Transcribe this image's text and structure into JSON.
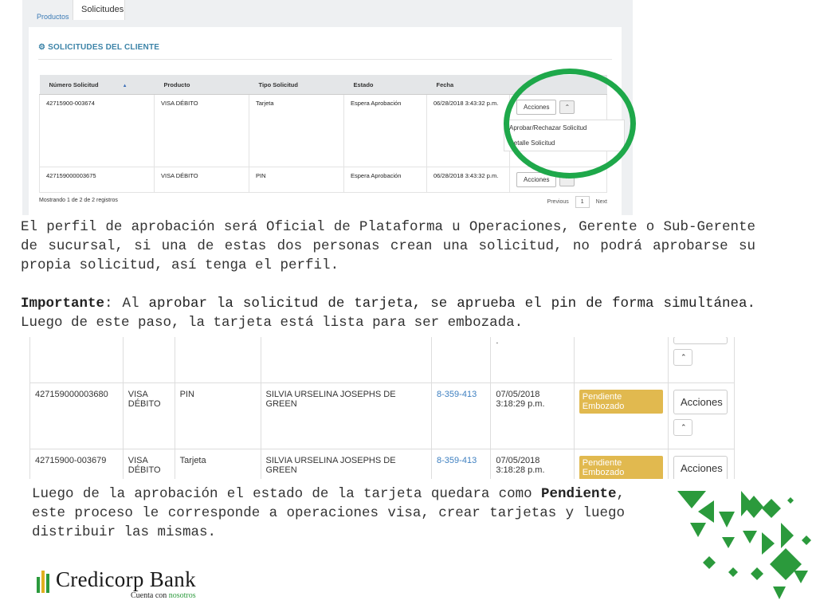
{
  "top_panel": {
    "tabs": [
      "Productos",
      "Solicitudes"
    ],
    "title": "SOLICITUDES DEL CLIENTE",
    "columns": [
      "Número Solicitud",
      "Producto",
      "Tipo Solicitud",
      "Estado",
      "Fecha"
    ],
    "rows": [
      {
        "numero": "42715900-003674",
        "producto": "VISA DÉBITO",
        "tipo": "Tarjeta",
        "estado": "Espera Aprobación",
        "fecha": "06/28/2018 3:43:32 p.m.",
        "accion": "Acciones"
      },
      {
        "numero": "427159000003675",
        "producto": "VISA DÉBITO",
        "tipo": "PIN",
        "estado": "Espera Aprobación",
        "fecha": "06/28/2018 3:43:32 p.m.",
        "accion": "Acciones"
      }
    ],
    "dropdown": [
      "Aprobar/Rechazar Solicitud",
      "Detalle Solicitud"
    ],
    "footer": "Mostrando 1 de 2 de 2 registros",
    "pager": {
      "prev": "Previous",
      "page": "1",
      "next": "Next"
    }
  },
  "text": {
    "p1": "El perfil de aprobación será Oficial de Plataforma u Operaciones, Gerente o Sub-Gerente de sucursal, si una de estas dos personas crean una solicitud, no podrá aprobarse su propia solicitud, así tenga el perfil.",
    "p2_label": "Importante",
    "p2_colon": ":",
    "p2_lead": " Al ",
    "p2_bold": "aprobar la solicitud de tarjeta, se aprueba el pin de forma simultánea.",
    "p2_rest": "  Luego de este paso, la tarjeta está lista para ser embozada.",
    "p3_a": "Luego de la aprobación el estado de la tarjeta quedara como ",
    "p3_bold": "Pendiente",
    "p3_b": ", este proceso le corresponde a operaciones visa, crear tarjetas y luego distribuir las mismas."
  },
  "bottom_panel": {
    "partial_row": {
      "fecha": "."
    },
    "rows": [
      {
        "numero": "427159000003680",
        "producto": "VISA DÉBITO",
        "tipo": "PIN",
        "cliente": "SILVIA URSELINA JOSEPHS DE GREEN",
        "id": "8-359-413",
        "fecha": "07/05/2018 3:18:29 p.m.",
        "estado": "Pendiente Embozado",
        "accion": "Acciones"
      },
      {
        "numero": "42715900-003679",
        "producto": "VISA DÉBITO",
        "tipo": "Tarjeta",
        "cliente": "SILVIA URSELINA JOSEPHS DE GREEN",
        "id": "8-359-413",
        "fecha": "07/05/2018 3:18:28 p.m.",
        "estado": "Pendiente Embozado",
        "accion": "Acciones"
      }
    ]
  },
  "logo": {
    "name": "Credicorp Bank",
    "tagline_a": "Cuenta con ",
    "tagline_b": "nosotros"
  },
  "colors": {
    "accent_green": "#1ea84a",
    "badge": "#e1b94f",
    "link": "#3d7fc0"
  }
}
